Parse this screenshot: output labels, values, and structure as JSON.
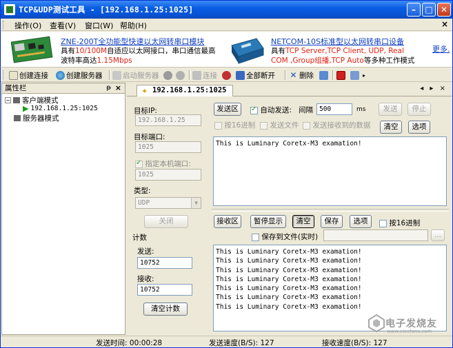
{
  "window": {
    "title": "TCP&UDP测试工具 - [192.168.1.25:1025]"
  },
  "menu": [
    {
      "label": "操作(O)"
    },
    {
      "label": "查看(V)"
    },
    {
      "label": "窗口(W)"
    },
    {
      "label": "帮助(H)"
    }
  ],
  "banner": {
    "ad1_title": "ZNE-200T全功能型快速以太网转串口模块",
    "ad1_line1_a": "具有",
    "ad1_line1_red": "10/100M",
    "ad1_line1_b": "自适应以太网接口，串口通信最高",
    "ad1_line2_a": "波特率高达",
    "ad1_line2_red": "1.15Mbps",
    "ad2_title": "NETCOM-10S标准型以太网转串口设备",
    "ad2_line1_a": "具有",
    "ad2_line1_red": "TCP Server,TCP Client, UDP, Real",
    "ad2_line2_red": "COM ,Group组播,TCP Auto",
    "ad2_line2_b": "等多种工作模式",
    "more": "更多."
  },
  "toolbar": {
    "create_conn": "创建连接",
    "create_server": "创建服务器",
    "start_server": "启动服务器",
    "connect": "连接",
    "disconnect_all": "全部断开",
    "delete": "删除"
  },
  "left_panel": {
    "title": "属性栏",
    "pin": "ᵽ",
    "close": "×",
    "client_mode": "客户端模式",
    "connection": "192.168.1.25:1025",
    "server_mode": "服务器模式"
  },
  "tab": {
    "label": "192.168.1.25:1025",
    "nav": "◂ ▸ ×"
  },
  "settings": {
    "target_ip_label": "目标IP:",
    "target_ip": "192.168.1.25",
    "target_port_label": "目标端口:",
    "target_port": "1025",
    "local_port_label": "指定本机端口:",
    "local_port": "1025",
    "type_label": "类型:",
    "type_value": "UDP",
    "close_button": "关闭",
    "count_label": "计数",
    "sent_label": "发送:",
    "sent_count": "10752",
    "recv_label": "接收:",
    "recv_count": "10752",
    "clear_count_button": "清空计数"
  },
  "send": {
    "section_button": "发送区",
    "auto_send_label": "自动发送:",
    "interval_label": "间隔",
    "interval_value": "500",
    "unit": "ms",
    "send_button": "发送",
    "stop_button": "停止",
    "hex_label": "按16进制",
    "send_file_label": "发送文件",
    "send_received_label": "发送接收到的数据",
    "clear_button": "清空",
    "options_button": "选项",
    "content": "This is Luminary Coretx-M3 examation!"
  },
  "receive": {
    "section_button": "接收区",
    "pause_button": "暂停显示",
    "clear_button": "清空",
    "save_button": "保存",
    "options_button": "选项",
    "hex_label": "按16进制",
    "save_to_file_label": "保存到文件(实时)",
    "browse_button": "...",
    "lines": [
      "This is Luminary Coretx-M3 examation!",
      "This is Luminary Coretx-M3 examation!",
      "This is Luminary Coretx-M3 examation!",
      "This is Luminary Coretx-M3 examation!",
      "This is Luminary Coretx-M3 examation!",
      "This is Luminary Coretx-M3 examation!",
      "This is Luminary Coretx-M3 examation!"
    ]
  },
  "status": {
    "send_time_label": "发送时间:",
    "send_time": "00:00:28",
    "send_speed_label": "发送速度(B/S):",
    "send_speed": "127",
    "recv_speed_label": "接收速度(B/S):",
    "recv_speed": "127"
  },
  "watermark": {
    "text": "电子发烧友",
    "sub": "www.elecfans.com"
  }
}
